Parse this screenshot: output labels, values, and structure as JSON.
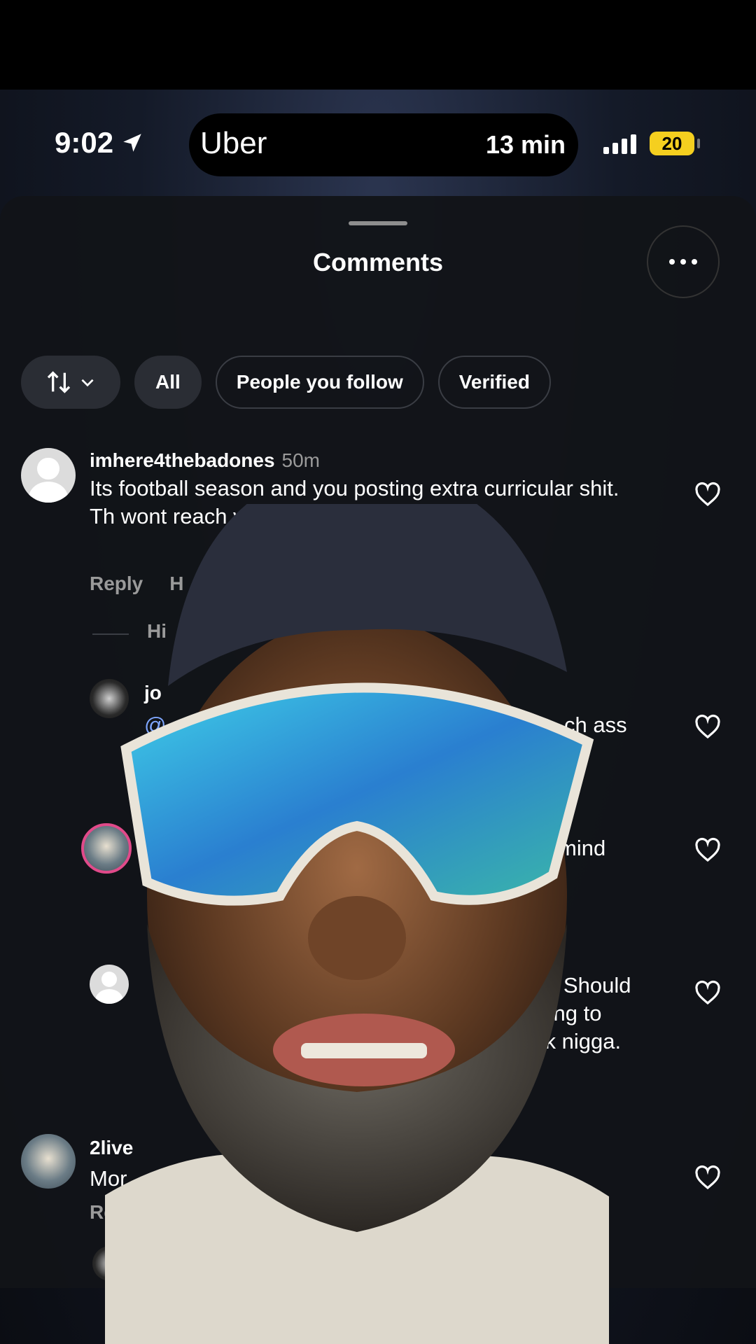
{
  "status_bar": {
    "time": "9:02",
    "live_activity_brand": "Uber",
    "live_activity_eta": "13 min",
    "battery": "20"
  },
  "sheet": {
    "title": "Comments",
    "filters": {
      "all": "All",
      "people_you_follow": "People you follow",
      "verified": "Verified"
    }
  },
  "comments": [
    {
      "username": "imhere4thebadones",
      "time": "50m",
      "text": "Its football season and you posting extra curricular shit. Th          wont reach your full football",
      "reply": "Reply",
      "extra": "H"
    },
    {
      "hide": "Hi"
    },
    {
      "username": "jo",
      "text": "@",
      "text_tail": "ch ass"
    },
    {
      "text_tail": "mind"
    },
    {
      "text_tail_1": "You Should",
      "text_tail_2": "plying to",
      "text_tail_3": "eek nigga."
    },
    {
      "username": "2live",
      "text": "Mor",
      "text_tail": "!!!!",
      "reply": "Reply"
    }
  ],
  "colors": {
    "accent_battery": "#f5cf1f",
    "sheet_bg": "#121418",
    "muted_text": "#9a9a9a"
  }
}
